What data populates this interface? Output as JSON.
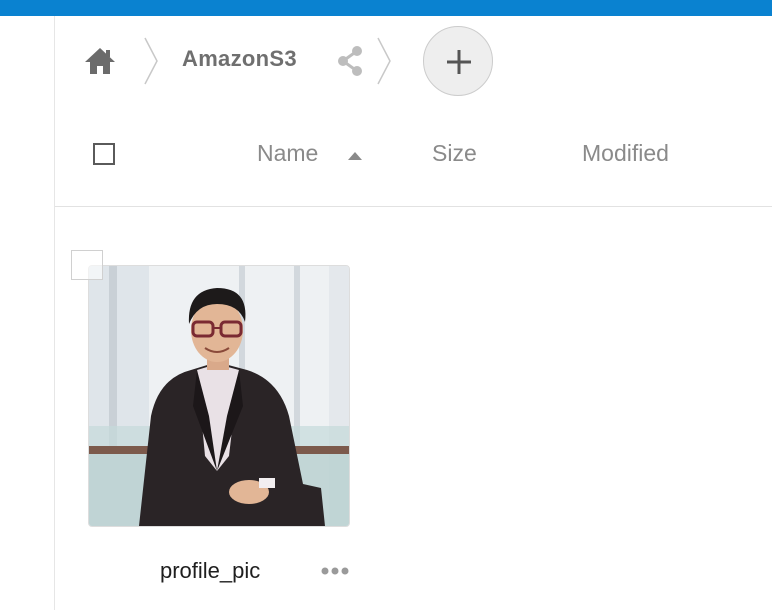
{
  "header": {
    "accent_color": "#0a82d0"
  },
  "breadcrumb": {
    "home_icon": "home-icon",
    "current_folder": "AmazonS3",
    "share_icon": "share-icon",
    "add_button_icon": "plus-icon"
  },
  "columns": {
    "name": "Name",
    "size": "Size",
    "modified": "Modified",
    "sort_column": "Name",
    "sort_direction": "ascending"
  },
  "files": [
    {
      "name": "profile_pic",
      "type": "image",
      "more_icon": "more-horizontal-icon"
    }
  ]
}
